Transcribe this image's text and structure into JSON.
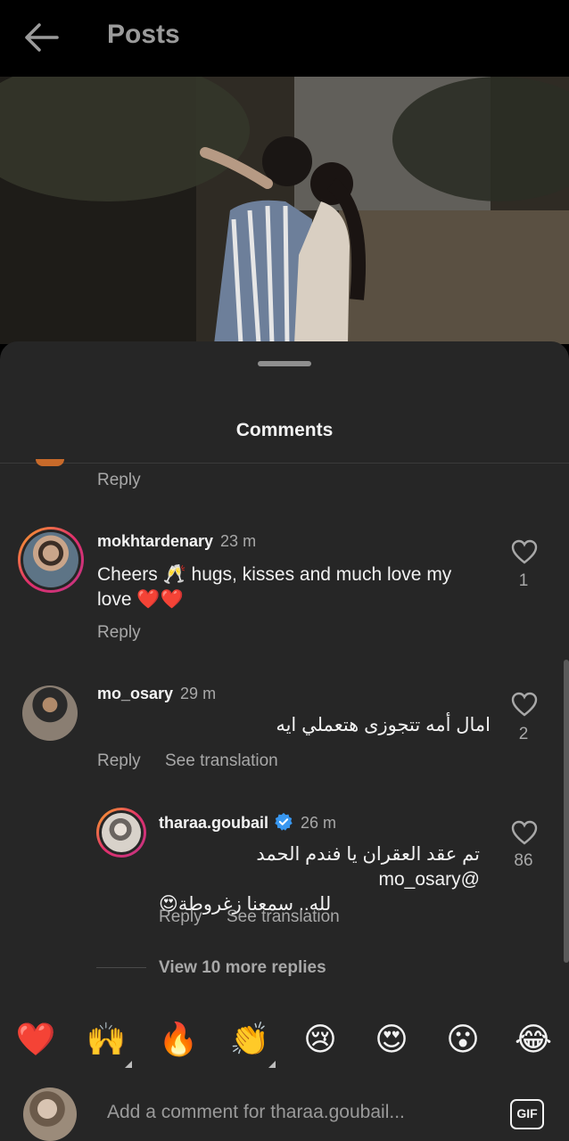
{
  "header": {
    "title": "Posts",
    "back_icon": "arrow-left-icon"
  },
  "sheet": {
    "title": "Comments"
  },
  "previous_comment": {
    "reply_label": "Reply"
  },
  "comments": [
    {
      "username": "mokhtardenary",
      "time": "23 m",
      "text_line1": "Cheers 🥂 hugs, kisses and much love my",
      "text_line2": "love ❤️❤️",
      "likes": "1",
      "reply_label": "Reply",
      "has_story_ring": true
    },
    {
      "username": "mo_osary",
      "time": "29 m",
      "text": "امال أمه تتجوزى هتعملي ايه",
      "likes": "2",
      "reply_label": "Reply",
      "translate_label": "See translation",
      "has_story_ring": false
    }
  ],
  "reply": {
    "username": "tharaa.goubail",
    "verified": true,
    "time": "26 m",
    "text_line1": "تم عقد العقران يا فندم الحمد @mo_osary",
    "text_line2": "لله.. سمعنا زغروطة😍",
    "likes": "86",
    "reply_label": "Reply",
    "translate_label": "See translation",
    "has_story_ring": true
  },
  "view_more_replies": "View 10 more replies",
  "quick_reactions": [
    "❤️",
    "🙌",
    "🔥",
    "👏",
    "😢",
    "😍",
    "😮",
    "😂"
  ],
  "composer": {
    "placeholder": "Add a comment for tharaa.goubail...",
    "gif_label": "GIF"
  },
  "colors": {
    "sheet_bg": "#262626",
    "secondary_text": "#a8a8a8",
    "verified_blue": "#3897f0"
  }
}
